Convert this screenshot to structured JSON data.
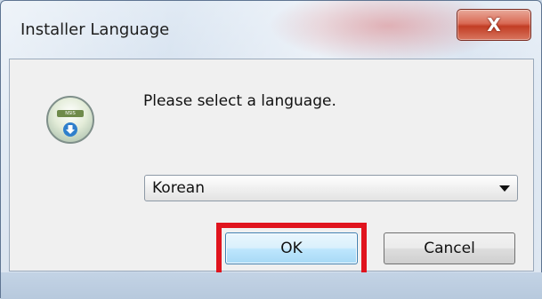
{
  "window": {
    "title": "Installer Language",
    "close_label": "X"
  },
  "icon": {
    "name": "installer-app-icon",
    "logo_text": "NSIS"
  },
  "dialog": {
    "message": "Please select a language.",
    "language_select": {
      "selected": "Korean"
    },
    "buttons": {
      "ok_label": "OK",
      "cancel_label": "Cancel"
    }
  },
  "colors": {
    "highlight": "#e0141e",
    "ok_border": "#3c7fb1",
    "close_red": "#c23d24"
  }
}
